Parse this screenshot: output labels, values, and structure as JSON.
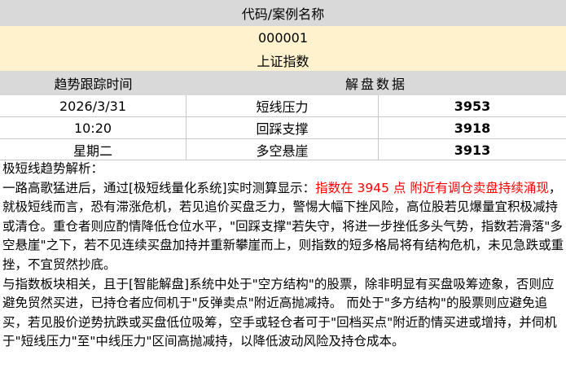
{
  "header": {
    "title": "代码/案例名称",
    "code": "000001",
    "name": "上证指数",
    "col_time": "趋势跟踪时间",
    "col_data": "解盘数据"
  },
  "rows": [
    {
      "time": "2026/3/31",
      "label": "短线压力",
      "value": "3953"
    },
    {
      "time": "10:20",
      "label": "回踩支撑",
      "value": "3918"
    },
    {
      "time": "星期二",
      "label": "多空悬崖",
      "value": "3913"
    }
  ],
  "analysis": {
    "heading": "极短线趋势解析：",
    "p1_before": "一路高歌猛进后，通过[极短线量化系统]实时测算显示：",
    "p1_highlight": "指数在 3945 点 附近有调仓卖盘持续涌现",
    "p1_after": "，就极短线而言，恐有滞涨危机，若见追价买盘乏力，警惕大幅下挫风险，高位股若见爆量宜积极减持或清仓。重仓者则应酌情降低仓位水平，\"回踩支撑\"若失守，将进一步挫低多头气势，指数若滑落\"多空悬崖\"之下，若不见连续买盘加持并重新攀崖而上，则指数的短多格局将有结构危机，未见急跌或重挫，不宜贸然抄底。",
    "p2": "与指数板块相关，且于[智能解盘]系统中处于\"空方结构\"的股票，除非明显有买盘吸筹迹象，否则应避免贸然买进，已持仓者应伺机于\"反弹卖点\"附近高抛减持。 而处于\"多方结构\"的股票则应避免追买，若见股价逆势抗跌或买盘低位吸筹，空手或轻仓者可于\"回档买点\"附近酌情买进或增持，并伺机于\"短线压力\"至\"中线压力\"区间高抛减持，以降低波动风险及持仓成本。"
  },
  "colors": {
    "header_grey": "#d9d9d9",
    "header_yellow": "#fff2cc",
    "highlight_red": "#ff0000"
  }
}
